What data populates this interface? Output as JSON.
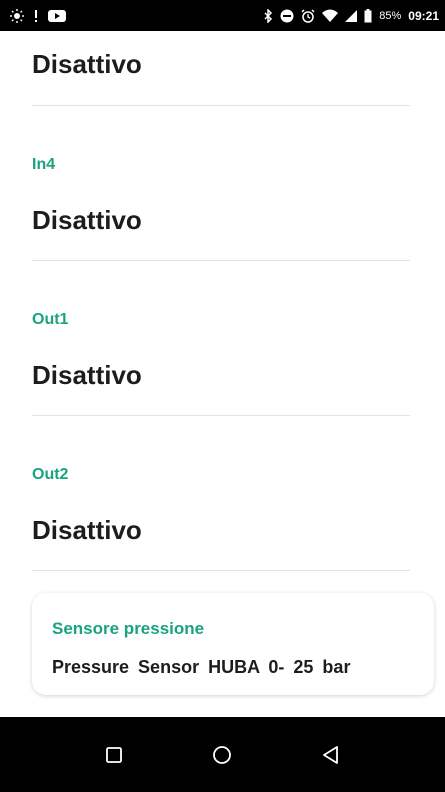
{
  "statusbar": {
    "battery_text": "85%",
    "time": "09:21",
    "icons_left": [
      "brightness-icon",
      "alert-icon",
      "youtube-icon"
    ],
    "icons_right": [
      "bluetooth-icon",
      "do-not-disturb-icon",
      "alarm-icon",
      "wifi-icon",
      "signal-icon",
      "battery-icon"
    ]
  },
  "rows": [
    {
      "label": "",
      "value": "Disattivo"
    },
    {
      "label": "In4",
      "value": "Disattivo"
    },
    {
      "label": "Out1",
      "value": "Disattivo"
    },
    {
      "label": "Out2",
      "value": "Disattivo"
    }
  ],
  "card": {
    "label": "Sensore pressione",
    "value": "Pressure Sensor HUBA 0- 25 bar"
  },
  "colors": {
    "accent": "#1aa37f",
    "text": "#1d1d1d",
    "divider": "#e3e3e3"
  },
  "navbar": {
    "buttons": [
      "recent-apps-icon",
      "home-icon",
      "back-icon"
    ]
  }
}
